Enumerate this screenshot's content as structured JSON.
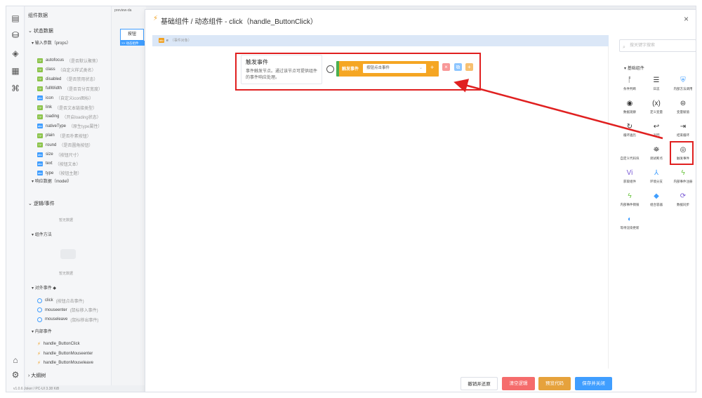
{
  "sidebar": {
    "title": "组件数据",
    "state_data": "状态数据",
    "input_props": "输入参数（props）",
    "props": [
      {
        "badge": "TF",
        "name": "autofocus",
        "desc": "（是否默认聚焦）"
      },
      {
        "badge": "TF",
        "name": "class",
        "desc": "（自定义样式类名）"
      },
      {
        "badge": "TF",
        "name": "disabled",
        "desc": "（是否禁用状态）"
      },
      {
        "badge": "TF",
        "name": "fullWidth",
        "desc": "（是否百分百宽度）"
      },
      {
        "badge": "abc",
        "name": "icon",
        "desc": "（自定义icon图标）"
      },
      {
        "badge": "TF",
        "name": "link",
        "desc": "（是否文本链接类型）"
      },
      {
        "badge": "TF",
        "name": "loading",
        "desc": "（开启loading状态）"
      },
      {
        "badge": "abc",
        "name": "nativeType",
        "desc": "（原生type属性）"
      },
      {
        "badge": "TF",
        "name": "plain",
        "desc": "（是否朴素按钮）"
      },
      {
        "badge": "TF",
        "name": "round",
        "desc": "（是否圆角按钮）"
      },
      {
        "badge": "abc",
        "name": "size",
        "desc": "（按钮尺寸）"
      },
      {
        "badge": "abc",
        "name": "text",
        "desc": "（按钮文本）"
      },
      {
        "badge": "abc",
        "name": "type",
        "desc": "（按钮主题）"
      }
    ],
    "model_data": "响应数据（model）",
    "logic_events": "逻辑/事件",
    "empty1": "暂无数据",
    "component_methods": "组件方法",
    "empty2": "暂无数据",
    "external_events": "对外事件",
    "events": [
      {
        "name": "click",
        "desc": "(按钮点击事件)"
      },
      {
        "name": "mouseenter",
        "desc": "(鼠标移入事件)"
      },
      {
        "name": "mouseleave",
        "desc": "(鼠标移出事件)"
      }
    ],
    "internal_events": "内部事件",
    "handlers": [
      "handle_ButtonClick",
      "handle_ButtonMouseenter",
      "handle_ButtonMouseleave"
    ],
    "outline": "大纲树"
  },
  "footer": {
    "version": "v1.0.6",
    "user": "Joker / PC-UI",
    "size": "3.38 KiB"
  },
  "preview": {
    "tab": "preview-da",
    "button": "按钮",
    "tag": ">> 动态组件"
  },
  "modal": {
    "title": "基础组件 / 动态组件 - click（handle_ButtonClick）",
    "close": "×",
    "topbar_badge": "abc",
    "topbar_param": "e",
    "topbar_hint": "（事件对象）",
    "node": {
      "title": "触发事件",
      "desc": "事件触发节点。通过该节点可提供组件的事件响应处理。",
      "bar_label": "触发事件",
      "select_placeholder": "按钮点击事件"
    },
    "buttons": {
      "cancel": "撤销并还原",
      "clear": "清空逻辑",
      "preview": "预览代码",
      "save": "保存并关闭"
    }
  },
  "palette": {
    "search_placeholder": "搜关键字搜索",
    "section": "基础组件",
    "items": [
      {
        "label": "条件判断",
        "icon": "branch-icon"
      },
      {
        "label": "日志",
        "icon": "log-icon"
      },
      {
        "label": "内部方法调用",
        "icon": "shield-icon"
      },
      {
        "label": "数据观察",
        "icon": "eye-icon"
      },
      {
        "label": "定义变量",
        "icon": "variable-icon"
      },
      {
        "label": "变量赋值",
        "icon": "assign-icon"
      },
      {
        "label": "循环遍历",
        "icon": "loop-icon"
      },
      {
        "label": "返回",
        "icon": "return-icon"
      },
      {
        "label": "结束循环",
        "icon": "break-icon"
      },
      {
        "label": "自定义代码块",
        "icon": "code-icon"
      },
      {
        "label": "调试断点",
        "icon": "debug-icon"
      },
      {
        "label": "触发事件",
        "icon": "trigger-icon"
      },
      {
        "label": "获取组件",
        "icon": "component-icon"
      },
      {
        "label": "环境分支",
        "icon": "env-branch-icon"
      },
      {
        "label": "内部事件注册",
        "icon": "register-icon"
      },
      {
        "label": "内部事件销毁",
        "icon": "destroy-icon"
      },
      {
        "label": "组合容器",
        "icon": "cube-icon"
      },
      {
        "label": "数据同步",
        "icon": "sync-icon"
      },
      {
        "label": "等待渲染更新",
        "icon": "wait-icon"
      }
    ]
  }
}
